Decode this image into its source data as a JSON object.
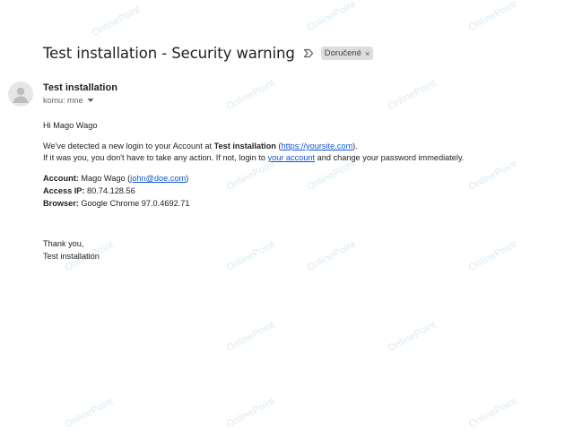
{
  "email": {
    "subject": "Test installation - Security warning",
    "label_chip": "Doručené",
    "sender_name": "Test installation",
    "recipient_line": "komu: mne"
  },
  "body": {
    "greeting": "Hi Mago Wago",
    "p1_prefix": "We've detected a new login to your Account at ",
    "p1_site_name": "Test installation",
    "p1_open_paren": " (",
    "p1_site_link": "https://yoursite.com",
    "p1_close": ").",
    "p2_prefix": "If it was you, you don't have to take any action. If not, login to ",
    "p2_link": "your account",
    "p2_suffix": " and change your password immediately.",
    "account_label": "Account:",
    "account_name": " Mago Wago (",
    "account_email": "john@doe.com",
    "account_close": ")",
    "ip_label": "Access IP:",
    "ip_value": " 80.74.128.56",
    "browser_label": "Browser:",
    "browser_value": " Google Chrome 97.0.4692.71",
    "thanks": "Thank you,",
    "signature": "Test installation"
  },
  "watermark": {
    "text": "OnlinePoint"
  },
  "icons": {
    "important_marker": "label-arrow-icon",
    "chip_remove": "close-icon",
    "avatar": "person-icon",
    "recipient_dropdown": "caret-down-icon"
  }
}
